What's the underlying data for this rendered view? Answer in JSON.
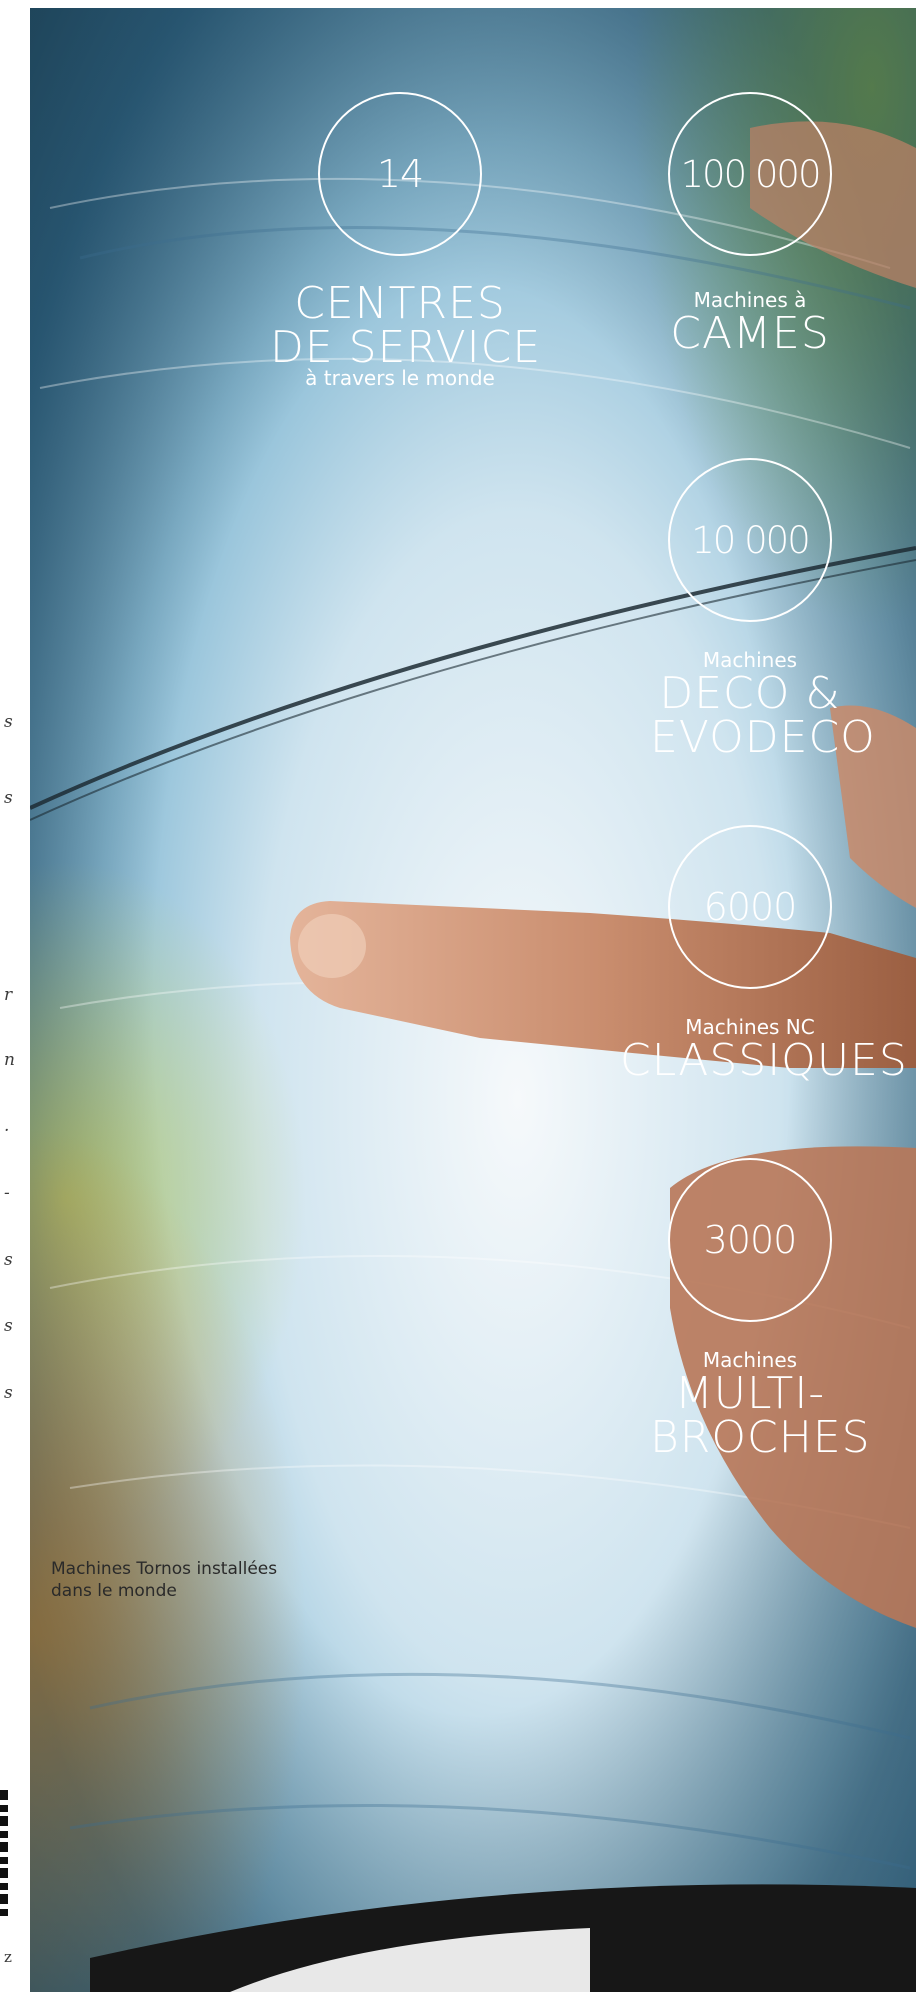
{
  "stats": [
    {
      "number": "14",
      "small": "",
      "large": [
        "CENTRES",
        "DE SERVICE"
      ],
      "sub": "à travers le monde"
    },
    {
      "number": "100 000",
      "small": "Machines à",
      "large": [
        "CAMES"
      ],
      "sub": ""
    },
    {
      "number": "10 000",
      "small": "Machines",
      "large": [
        "DECO &",
        "EVODECO"
      ],
      "sub": ""
    },
    {
      "number": "6000",
      "small": "Machines NC",
      "large": [
        "CLASSIQUES"
      ],
      "sub": ""
    },
    {
      "number": "3000",
      "small": "Machines",
      "large": [
        "MULTI-",
        "BROCHES"
      ],
      "sub": ""
    }
  ],
  "caption": {
    "line1": "Machines Tornos installées",
    "line2": "dans le monde"
  },
  "gutter": {
    "marks": [
      "s",
      "s",
      "r",
      "n",
      ".",
      "-",
      "s",
      "s",
      "s",
      "z"
    ]
  },
  "colors": {
    "text_on_photo": "#ffffff",
    "caption": "#2a2a2a"
  }
}
